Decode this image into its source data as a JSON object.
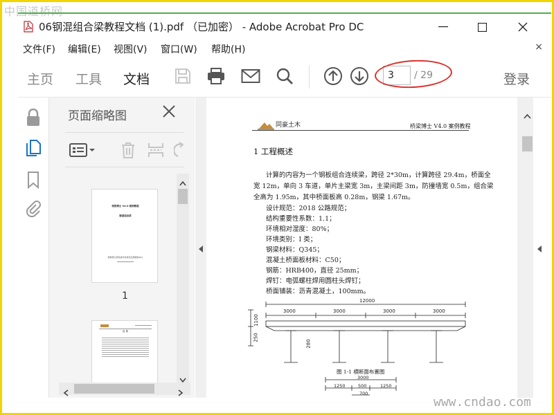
{
  "watermark_top": "中国道桥网",
  "watermark_bottom": "www.cndao.com",
  "window": {
    "title": "06钢混组合梁教程文档 (1).pdf （已加密） - Adobe Acrobat Pro DC",
    "minimize": "—",
    "maximize": "☐",
    "close": "✕"
  },
  "menu": {
    "items": [
      "文件(F)",
      "编辑(E)",
      "视图(V)",
      "窗口(W)",
      "帮助(H)"
    ],
    "close": "×"
  },
  "toolbar": {
    "tabs": [
      "主页",
      "工具",
      "文档"
    ],
    "active_tab": "文档",
    "current_page": "3",
    "total_pages": "/ 29",
    "login": "登录",
    "icons": [
      "save-icon",
      "print-icon",
      "mail-icon",
      "search-icon",
      "page-up-icon",
      "page-down-icon"
    ]
  },
  "thumb_panel": {
    "title": "页面缩略图",
    "close": "✕",
    "pages": [
      {
        "label": "1",
        "line1": "桥梁博士 V4.0 案例教程",
        "line2": "钢混组合梁",
        "line3": "桥梁博士软件技术支持及应用服务中心"
      },
      {
        "label": "",
        "line1": "目 录"
      }
    ]
  },
  "document": {
    "logo_text": "同豪土木",
    "header_right": "桥梁博士 V4.0 案例教程",
    "heading": "1   工程概述",
    "paragraph": [
      "计算的内容为一个钢板组合连续梁，跨径 2*30m，计算跨径 29.4m，桥面全",
      "宽 12m，单向 3 车道，单片主梁宽 3m，主梁间距 3m，防撞墙宽 0.5m，组合梁",
      "全高为 1.95m，其中桥面板高 0.28m，钢梁 1.67m。"
    ],
    "list": [
      "设计规范：2018 公路规范；",
      "结构重要性系数：1.1；",
      "环境相对湿度：80%；",
      "环境类别：I 类；",
      "钢梁材料：Q345；",
      "混凝土桥面板材料：C50；",
      "钢筋：HRB400，直径 25mm；",
      "焊钉：电弧螺柱焊用圆柱头焊钉；",
      "桥面铺装：沥青混凝土，100mm。"
    ],
    "figure": {
      "total_width": "12000",
      "segments": [
        "3000",
        "3000",
        "3000",
        "3000"
      ],
      "dim_left_top": "1100",
      "dim_left_bottom": "250",
      "dim_small": "280",
      "caption": "图 1-1  横断面布置图",
      "detail_top": "3000",
      "detail_parts": [
        "1250",
        "500",
        "1250"
      ],
      "detail_bottom": "700"
    }
  },
  "colors": {
    "frame": "#f2d400",
    "accent_green": "#4caf50",
    "annotation_red": "#d9302c"
  }
}
